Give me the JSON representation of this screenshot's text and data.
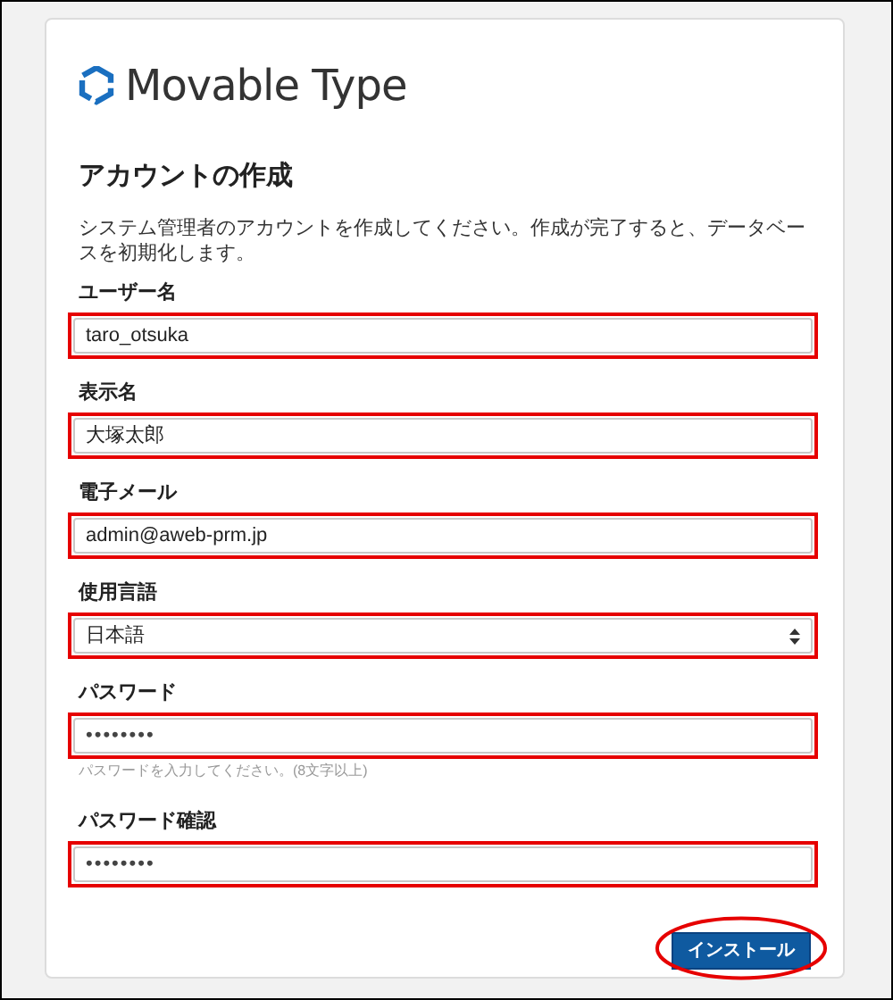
{
  "logo": {
    "text": "Movable Type"
  },
  "heading": "アカウントの作成",
  "description": "システム管理者のアカウントを作成してください。作成が完了すると、データベースを初期化します。",
  "fields": [
    {
      "kind": "text",
      "label": "ユーザー名",
      "value": "taro_otsuka",
      "highlighted": true
    },
    {
      "kind": "text",
      "label": "表示名",
      "value": "大塚太郎",
      "highlighted": true
    },
    {
      "kind": "text",
      "label": "電子メール",
      "value": "admin@aweb-prm.jp",
      "highlighted": true
    },
    {
      "kind": "select",
      "label": "使用言語",
      "value": "日本語",
      "highlighted": true
    },
    {
      "kind": "password",
      "label": "パスワード",
      "value": "••••••••",
      "hint": "パスワードを入力してください。(8文字以上)",
      "highlighted": true
    },
    {
      "kind": "password",
      "label": "パスワード確認",
      "value": "••••••••",
      "highlighted": true
    }
  ],
  "button": {
    "label": "インストール",
    "circled": true
  }
}
